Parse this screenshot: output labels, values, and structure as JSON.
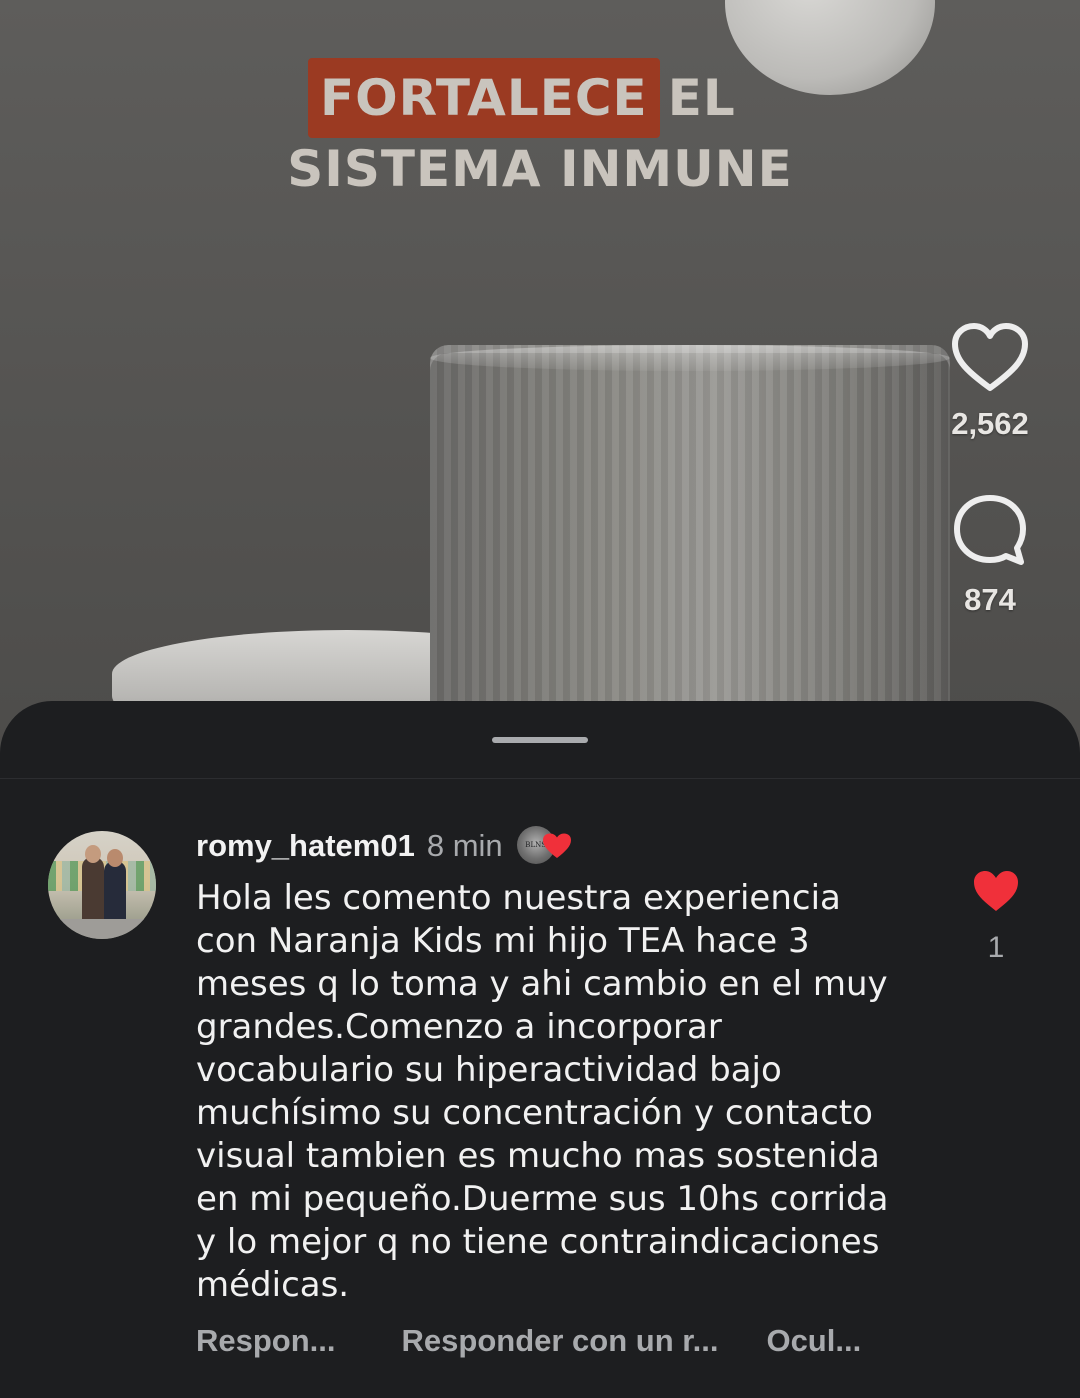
{
  "video": {
    "overlay_title": {
      "highlight": "FORTALECE",
      "plain": "EL",
      "line2": "SISTEMA INMUNE"
    },
    "actions": {
      "likes": "2,562",
      "comments": "874"
    }
  },
  "comment": {
    "username": "romy_hatem01",
    "time": "8 min",
    "creator_mark": "BLNS",
    "text": "Hola les comento nuestra experiencia\ncon Naranja Kids mi hijo TEA hace 3\nmeses q lo toma y ahi cambio en el muy\ngrandes.Comenzo a incorporar\nvocabulario su hiperactividad bajo\nmuchísimo su concentración y contacto\nvisual tambien es mucho mas sostenida\nen mi pequeño.Duerme sus 10hs corrida\ny lo mejor q no tiene contraindicaciones\nmédicas.",
    "like_count": "1",
    "buttons": {
      "reply": "Respon...",
      "reply_with_reel": "Responder con un r...",
      "hide": "Ocul..."
    }
  },
  "colors": {
    "sheet_bg": "#1d1e20",
    "highlight": "#9b3a22",
    "heart_red": "#f0303a"
  }
}
